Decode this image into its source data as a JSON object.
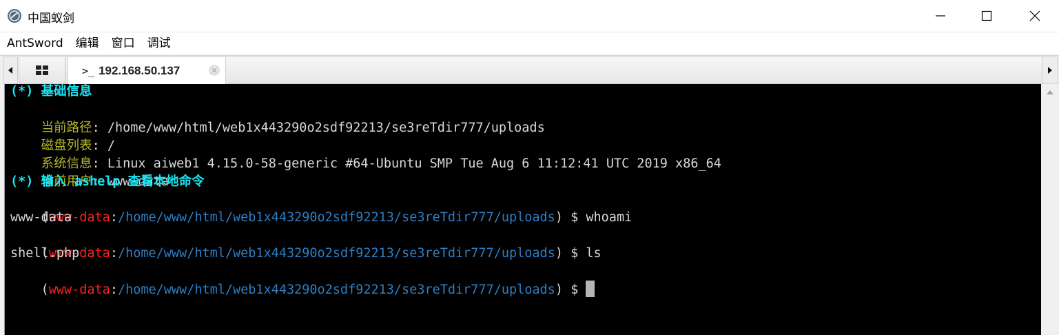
{
  "window": {
    "title": "中国蚁剑",
    "icon": "antsword-logo-icon",
    "controls": [
      "minimize-icon",
      "maximize-icon",
      "close-icon"
    ]
  },
  "menu": {
    "items": [
      "AntSword",
      "编辑",
      "窗口",
      "调试"
    ]
  },
  "tabs": {
    "grid_icon": "grid-icon",
    "active_prompt": ">_",
    "active_label": "192.168.50.137",
    "close_icon": "tab-close-icon"
  },
  "terminal": {
    "info_header": "(*) 基础信息",
    "info": [
      {
        "label": "当前路径",
        "value": ": /home/www/html/web1x443290o2sdf92213/se3reTdir777/uploads"
      },
      {
        "label": "磁盘列表",
        "value": ": /"
      },
      {
        "label": "系统信息",
        "value": ": Linux aiweb1 4.15.0-58-generic #64-Ubuntu SMP Tue Aug 6 11:12:41 UTC 2019 x86_64"
      },
      {
        "label": "当前用户",
        "value": ": www-data"
      }
    ],
    "help_header": "(*) 输入 ashelp 查看本地命令",
    "prompt": {
      "open": "(",
      "user": "www-data",
      "sep": ":",
      "path": "/home/www/html/web1x443290o2sdf92213/se3reTdir777/uploads",
      "close": ") $ "
    },
    "history": [
      {
        "command": "whoami",
        "output": "www-data"
      },
      {
        "command": "ls",
        "output": "shell.php"
      }
    ],
    "current_command": ""
  },
  "colors": {
    "terminal_bg": "#000000",
    "header_cyan": "#19e3f0",
    "label_olive": "#b3b62b",
    "user_red": "#ff2020",
    "path_blue": "#2e7ec4"
  }
}
